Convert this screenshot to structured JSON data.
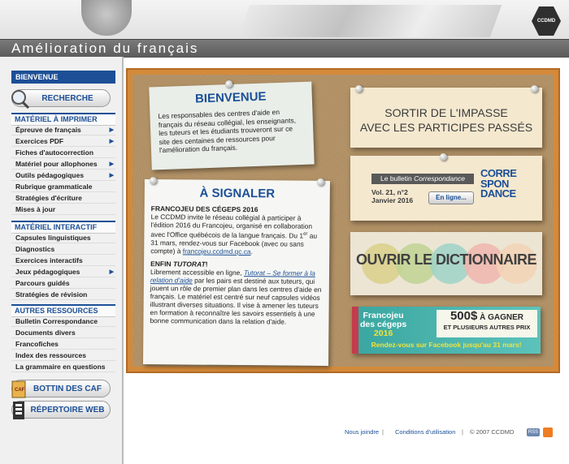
{
  "header": {
    "title": "Amélioration du français",
    "logo_text": "CCDMD"
  },
  "sidebar": {
    "active": "BIENVENUE",
    "search_button": "RECHERCHE",
    "sections": [
      {
        "title": "MATÉRIEL À IMPRIMER",
        "items": [
          {
            "label": "Épreuve de français",
            "arrow": true
          },
          {
            "label": "Exercices PDF",
            "arrow": true
          },
          {
            "label": "Fiches d'autocorrection",
            "arrow": false
          },
          {
            "label": "Matériel pour allophones",
            "arrow": true
          },
          {
            "label": "Outils pédagogiques",
            "arrow": true
          },
          {
            "label": "Rubrique grammaticale",
            "arrow": false
          },
          {
            "label": "Stratégies d'écriture",
            "arrow": false
          },
          {
            "label": "Mises à jour",
            "arrow": false
          }
        ]
      },
      {
        "title": "MATÉRIEL INTERACTIF",
        "items": [
          {
            "label": "Capsules linguistiques",
            "arrow": false
          },
          {
            "label": "Diagnostics",
            "arrow": false
          },
          {
            "label": "Exercices interactifs",
            "arrow": false
          },
          {
            "label": "Jeux pédagogiques",
            "arrow": true
          },
          {
            "label": "Parcours guidés",
            "arrow": false
          },
          {
            "label": "Stratégies de révision",
            "arrow": false
          }
        ]
      },
      {
        "title": "AUTRES RESSOURCES",
        "items": [
          {
            "label": "Bulletin Correspondance",
            "arrow": false
          },
          {
            "label": "Documents divers",
            "arrow": false
          },
          {
            "label": "Francofiches",
            "arrow": false
          },
          {
            "label": "Index des ressources",
            "arrow": false
          },
          {
            "label": "La grammaire en questions",
            "arrow": false
          }
        ]
      }
    ],
    "botton_button": "BOTTIN DES CAF",
    "repertoire_button": "RÉPERTOIRE WEB"
  },
  "welcome": {
    "title": "BIENVENUE",
    "text": "Les responsables des centres d'aide en français du réseau collégial, les enseignants, les tuteurs et les étudiants trouveront sur ce site des centaines de ressources pour l'amélioration du français."
  },
  "news": {
    "title": "À SIGNALER",
    "item1_title": "FRANCOJEU DES CÉGEPS 2016",
    "item1_text_a": "Le CCDMD invite le réseau collégial à participer à l'édition 2016 du Francojeu, organisé en collaboration avec l'Office québécois de la langue français. Du 1",
    "item1_sup": "er",
    "item1_text_b": " au 31 mars, rendez-vous sur Facebook (avec ou sans compte) à ",
    "item1_link": "francojeu.ccdmd.qc.ca",
    "item1_end": ".",
    "item2_title_a": "ENFIN ",
    "item2_title_b": "TUTORAT",
    "item2_title_c": "!",
    "item2_text_a": "Librement accessible en ligne, ",
    "item2_link": "Tutorat – Se former à la relation d'aide",
    "item2_text_b": " par les pairs est destiné aux tuteurs, qui jouent un rôle de premier plan dans les centres d'aide en français. Le matériel est centré sur neuf capsules vidéos illustrant diverses situations. Il vise à amener les tuteurs en formation à reconnaître les savoirs essentiels à une bonne communication dans la relation d'aide."
  },
  "banners": {
    "impasse_line1": "SORTIR DE L'IMPASSE",
    "impasse_line2": "AVEC LES PARTICIPES PASSÉS",
    "bulletin_prefix": "Le bulletin ",
    "bulletin_name": "Correspondance",
    "vol": "Vol. 21, n°2",
    "date": "Janvier 2016",
    "enligne": "En ligne...",
    "corr_lines": [
      "CORRE",
      "SPON",
      "DANCE"
    ],
    "dictionnaire": "OUVRIR LE DICTIONNAIRE",
    "francojeu_line1": "Francojeu",
    "francojeu_line2": "des cégeps",
    "francojeu_year": "2016",
    "prize_amount": "500$",
    "prize_text": " À GAGNER",
    "prize_sub": "ET PLUSIEURS AUTRES PRIX",
    "facebook": "Rendez-vous sur Facebook jusqu'au 31 mars!"
  },
  "footer": {
    "join": "Nous joindre",
    "sep1": "|",
    "terms": "Conditions d'utilisation",
    "sep2": "|",
    "copyright": "© 2007 CCDMD",
    "rss": "RSS"
  },
  "colors": {
    "brand_blue": "#1c4f96",
    "board_frame": "#d48a3a",
    "cork": "#b08f63"
  }
}
